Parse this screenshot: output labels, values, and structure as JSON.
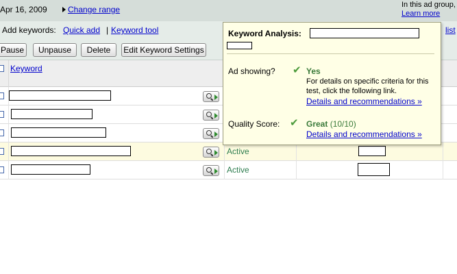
{
  "header": {
    "date": "Apr 16, 2009",
    "change_range": "Change range",
    "adgroup_line1": "In this ad group,",
    "adgroup_line2": "Learn more"
  },
  "keywords_bar": {
    "label": "Add keywords:",
    "quick_add": "Quick add",
    "separator": "|",
    "keyword_tool": "Keyword tool",
    "list_link": "list"
  },
  "toolbar": {
    "pause": "Pause",
    "unpause": "Unpause",
    "delete": "Delete",
    "edit_settings": "Edit Keyword Settings"
  },
  "table": {
    "header_keyword": "Keyword",
    "rows": [
      {
        "status": ""
      },
      {
        "status": ""
      },
      {
        "status": ""
      },
      {
        "status": "Active"
      },
      {
        "status": "Active"
      }
    ]
  },
  "popup": {
    "title": "Keyword Analysis:",
    "ad_showing_label": "Ad showing?",
    "ad_showing_value": "Yes",
    "details_text": "For details on specific criteria for this test, click the following link.",
    "details_link_1": "Details and recommendations »",
    "quality_label": "Quality Score:",
    "quality_value": "Great",
    "quality_score": "(10/10)",
    "details_link_2": "Details and recommendations »"
  },
  "colors": {
    "link": "#0000cc",
    "status_green": "#2e7d4f",
    "popup_bg": "#ffffe6",
    "highlight_row": "#fdfbe0"
  }
}
